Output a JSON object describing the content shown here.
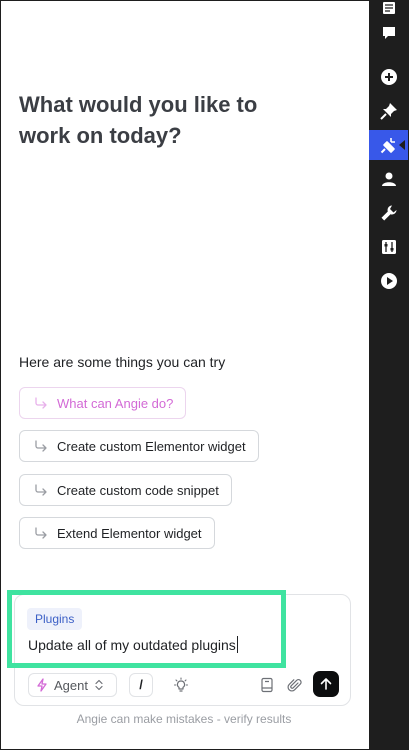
{
  "main": {
    "headline": "What would you like to work on today?",
    "suggestions_label": "Here are some things you can try",
    "suggestions": [
      {
        "label": "What can Angie do?",
        "muted": true
      },
      {
        "label": "Create custom Elementor widget"
      },
      {
        "label": "Create custom code snippet"
      },
      {
        "label": "Extend Elementor widget"
      }
    ]
  },
  "composer": {
    "tag": "Plugins",
    "prompt_text": "Update all of my outdated plugins",
    "mode_label": "Agent",
    "slash_label": "/",
    "disclaimer": "Angie can make mistakes - verify results"
  },
  "rail": {
    "icons": [
      "post-icon",
      "comment-icon",
      "add-icon",
      "pin-icon",
      "plugin-icon",
      "user-icon",
      "wrench-icon",
      "settings-sliders-icon",
      "play-icon"
    ],
    "active": "plugin-icon",
    "accent": "#3858e9"
  },
  "colors": {
    "highlight": "#3fe3a0",
    "tag_bg": "#eef1fb",
    "tag_text": "#3b5fc6",
    "muted_chip_text": "#d36ad6"
  }
}
